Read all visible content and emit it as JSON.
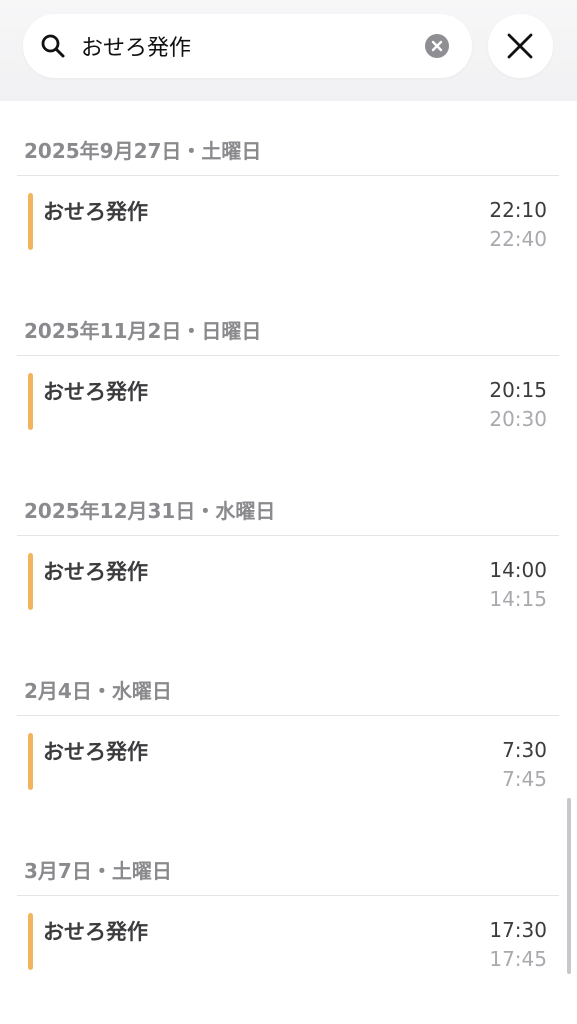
{
  "search": {
    "query": "おせろ発作",
    "placeholder": ""
  },
  "icons": {
    "search": "search-icon",
    "clear": "clear-icon",
    "close": "close-icon"
  },
  "colors": {
    "event_bar": "#f2b55d",
    "date_header": "#8a8a8e",
    "end_time": "#a9a9ae"
  },
  "groups": [
    {
      "date": "2025年9月27日・土曜日",
      "event": {
        "title": "おせろ発作",
        "start": "22:10",
        "end": "22:40"
      }
    },
    {
      "date": "2025年11月2日・日曜日",
      "event": {
        "title": "おせろ発作",
        "start": "20:15",
        "end": "20:30"
      }
    },
    {
      "date": "2025年12月31日・水曜日",
      "event": {
        "title": "おせろ発作",
        "start": "14:00",
        "end": "14:15"
      }
    },
    {
      "date": "2月4日・水曜日",
      "event": {
        "title": "おせろ発作",
        "start": "7:30",
        "end": "7:45"
      }
    },
    {
      "date": "3月7日・土曜日",
      "event": {
        "title": "おせろ発作",
        "start": "17:30",
        "end": "17:45"
      }
    }
  ]
}
